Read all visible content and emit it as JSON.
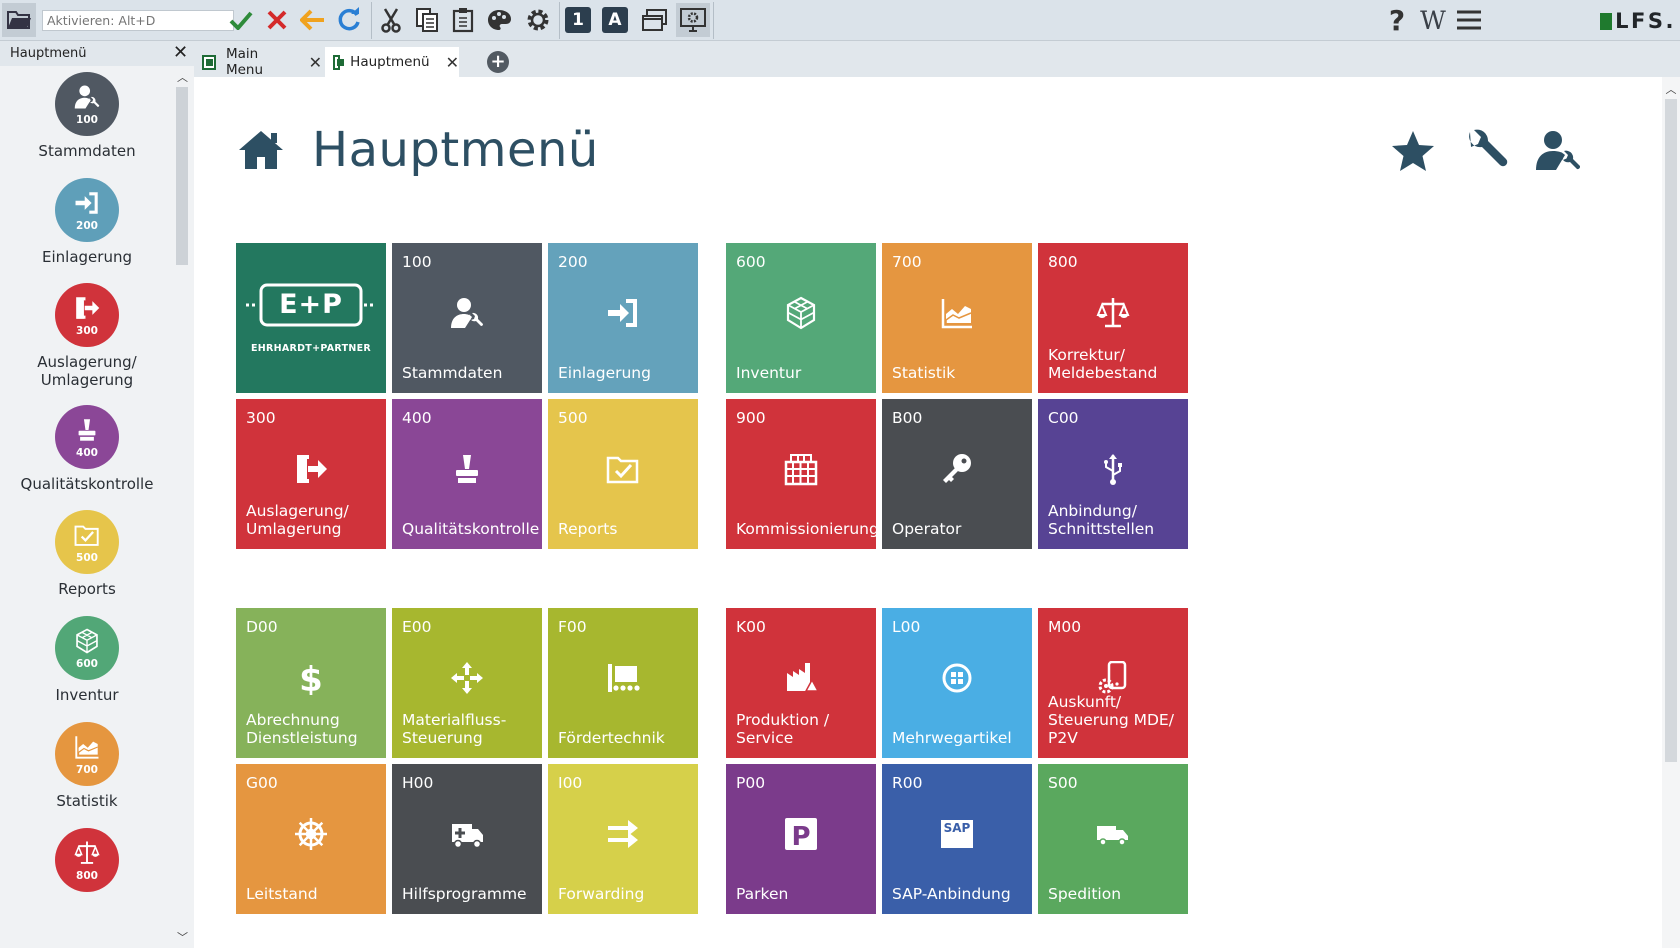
{
  "toolbar": {
    "activate_placeholder": "Aktivieren: Alt+D",
    "btn1_label": "1",
    "btnA_label": "A",
    "help_label": "?",
    "wiki_label": "W",
    "brand": "LFS."
  },
  "sidebar": {
    "title": "Hauptmenü",
    "items": [
      {
        "num": "100",
        "label": "Stammdaten",
        "color": "#505862",
        "icon": "user-wrench-icon"
      },
      {
        "num": "200",
        "label": "Einlagerung",
        "color": "#5f9fb9",
        "icon": "sign-in-icon"
      },
      {
        "num": "300",
        "label": "Auslagerung/\nUmlagerung",
        "color": "#d0333b",
        "icon": "sign-out-icon"
      },
      {
        "num": "400",
        "label": "Qualitätskontrolle",
        "color": "#8b4797",
        "icon": "stamp-icon"
      },
      {
        "num": "500",
        "label": "Reports",
        "color": "#e6c54b",
        "icon": "folder-check-icon"
      },
      {
        "num": "600",
        "label": "Inventur",
        "color": "#52a777",
        "icon": "cubes-icon"
      },
      {
        "num": "700",
        "label": "Statistik",
        "color": "#e5963f",
        "icon": "area-chart-icon"
      },
      {
        "num": "800",
        "label": "",
        "color": "#d0333b",
        "icon": "scale-icon"
      }
    ]
  },
  "tabs": [
    {
      "label": "Main Menu"
    },
    {
      "label": "Hauptmenü"
    }
  ],
  "main": {
    "title": "Hauptmenü",
    "logo_text": "E+P",
    "logo_sub": "EHRHARDT+PARTNER",
    "tiles": [
      {
        "code": "100",
        "label": "Stammdaten",
        "color": "#505862",
        "icon": "user-wrench-icon"
      },
      {
        "code": "200",
        "label": "Einlagerung",
        "color": "#64a2bb",
        "icon": "sign-in-icon"
      },
      {
        "code": "600",
        "label": "Inventur",
        "color": "#54a878",
        "icon": "cubes-icon"
      },
      {
        "code": "700",
        "label": "Statistik",
        "color": "#e59640",
        "icon": "area-chart-icon"
      },
      {
        "code": "800",
        "label": "Korrektur/\nMeldebestand",
        "color": "#d0333b",
        "icon": "scale-icon"
      },
      {
        "code": "300",
        "label": "Auslagerung/\nUmlagerung",
        "color": "#d0333b",
        "icon": "sign-out-icon"
      },
      {
        "code": "400",
        "label": "Qualitätskontrolle",
        "color": "#8a4796",
        "icon": "stamp-icon"
      },
      {
        "code": "500",
        "label": "Reports",
        "color": "#e5c54c",
        "icon": "folder-check-icon"
      },
      {
        "code": "900",
        "label": "Kommissionierung",
        "color": "#d0333b",
        "icon": "grid-icon"
      },
      {
        "code": "B00",
        "label": "Operator",
        "color": "#4a4d51",
        "icon": "key-icon"
      },
      {
        "code": "C00",
        "label": "Anbindung/\nSchnittstellen",
        "color": "#574394",
        "icon": "usb-icon"
      },
      {
        "code": "D00",
        "label": "Abrechnung\nDienstleistung",
        "color": "#86b25a",
        "icon": "dollar-icon"
      },
      {
        "code": "E00",
        "label": "Materialfluss-\nSteuerung",
        "color": "#a7b72f",
        "icon": "arrows-icon"
      },
      {
        "code": "F00",
        "label": "Fördertechnik",
        "color": "#a7b72f",
        "icon": "conveyor-icon"
      },
      {
        "code": "K00",
        "label": "Produktion /\nService",
        "color": "#d0333b",
        "icon": "production-icon"
      },
      {
        "code": "L00",
        "label": "Mehrwegartikel",
        "color": "#4aaee4",
        "icon": "recycle-icon"
      },
      {
        "code": "M00",
        "label": "Auskunft/\nSteuerung MDE/\nP2V",
        "color": "#d0333b",
        "icon": "mobile-gear-icon"
      },
      {
        "code": "G00",
        "label": "Leitstand",
        "color": "#e59640",
        "icon": "helm-icon"
      },
      {
        "code": "H00",
        "label": "Hilfsprogramme",
        "color": "#4a4d51",
        "icon": "ambulance-icon"
      },
      {
        "code": "I00",
        "label": "Forwarding",
        "color": "#d6d04a",
        "icon": "forward-arrows-icon"
      },
      {
        "code": "P00",
        "label": "Parken",
        "color": "#7b3b8b",
        "icon": "parking-icon"
      },
      {
        "code": "R00",
        "label": "SAP-Anbindung",
        "color": "#3a5fa9",
        "icon": "sap-icon"
      },
      {
        "code": "S00",
        "label": "Spedition",
        "color": "#5aa85e",
        "icon": "truck-icon"
      }
    ]
  }
}
